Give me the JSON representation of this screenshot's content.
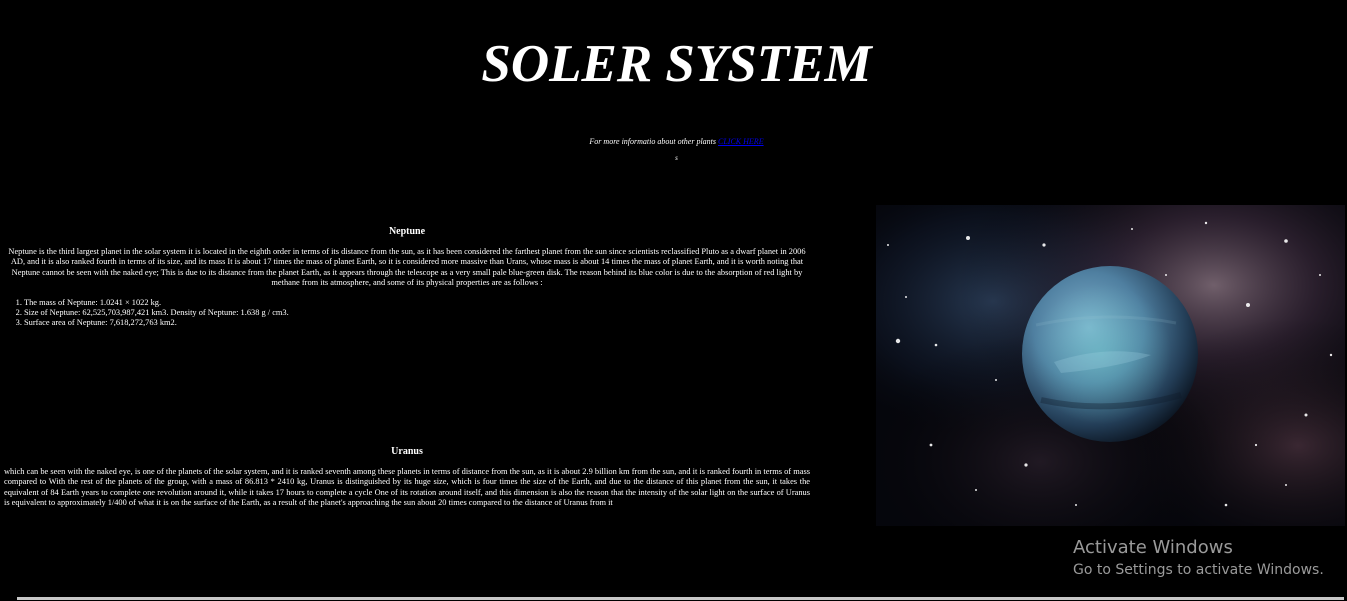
{
  "header": {
    "title": "SOLER SYSTEM",
    "more_info_text": "For more informatio about other plants ",
    "more_info_link": "CLICK HERE",
    "mark": "s"
  },
  "neptune": {
    "heading": "Neptune",
    "paragraph": "Neptune is the third largest planet in the solar system it is located in the eighth order in terms of its distance from the sun, as it has been considered the farthest planet from the sun since scientists reclassified Pluto as a dwarf planet in 2006 AD, and it is also ranked fourth in terms of its size, and its mass It is about 17 times the mass of planet Earth, so it is considered more massive than Urans, whose mass is about 14 times the mass of planet Earth, and it is worth noting that Neptune cannot be seen with the naked eye; This is due to its distance from the planet Earth, as it appears through the telescope as a very small pale blue-green disk. The reason behind its blue color is due to the absorption of red light by methane from its atmosphere, and some of its physical properties are as follows :",
    "properties": [
      "The mass of Neptune: 1.0241 × 1022 kg.",
      "Size of Neptune: 62,525,703,987,421 km3. Density of Neptune: 1.638 g / cm3.",
      "Surface area of Neptune: 7,618,272,763 km2."
    ]
  },
  "uranus": {
    "heading": "Uranus",
    "paragraph": "which can be seen with the naked eye, is one of the planets of the solar system, and it is ranked seventh among these planets in terms of distance from the sun, as it is about 2.9 billion km from the sun, and it is ranked fourth in terms of mass compared to With the rest of the planets of the group, with a mass of 86.813 * 2410 kg, Uranus is distinguished by its huge size, which is four times the size of the Earth, and due to the distance of this planet from the sun, it takes the equivalent of 84 Earth years to complete one revolution around it, while it takes 17 hours to complete a cycle One of its rotation around itself, and this dimension is also the reason that the intensity of the solar light on the surface of Uranus is equivalent to approximately 1/400 of what it is on the surface of the Earth, as a result of the planet's approaching the sun about 20 times compared to the distance of Uranus from it"
  },
  "watermark": {
    "title": "Activate Windows",
    "subtitle": "Go to Settings to activate Windows."
  },
  "colors": {
    "background": "#000000",
    "text": "#ffffff",
    "link": "#0000ee",
    "watermark": "#9a9a9a"
  }
}
